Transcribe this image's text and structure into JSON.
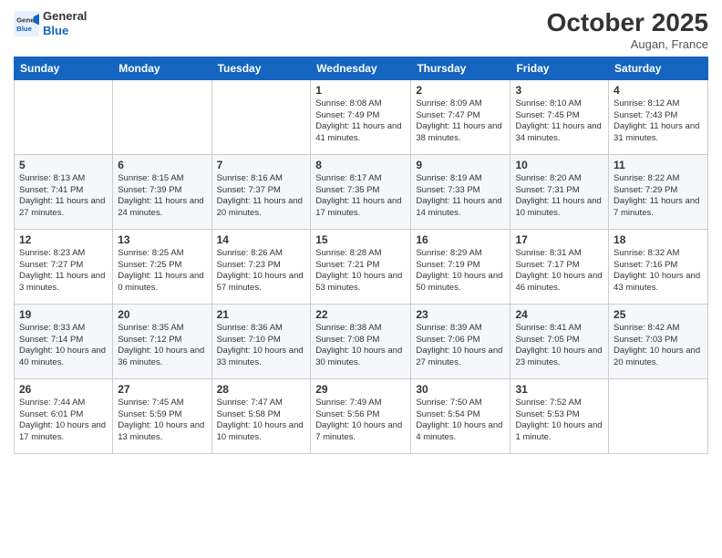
{
  "header": {
    "logo_line1": "General",
    "logo_line2": "Blue",
    "month": "October 2025",
    "location": "Augan, France"
  },
  "weekdays": [
    "Sunday",
    "Monday",
    "Tuesday",
    "Wednesday",
    "Thursday",
    "Friday",
    "Saturday"
  ],
  "weeks": [
    [
      {
        "day": "",
        "info": ""
      },
      {
        "day": "",
        "info": ""
      },
      {
        "day": "",
        "info": ""
      },
      {
        "day": "1",
        "info": "Sunrise: 8:08 AM\nSunset: 7:49 PM\nDaylight: 11 hours\nand 41 minutes."
      },
      {
        "day": "2",
        "info": "Sunrise: 8:09 AM\nSunset: 7:47 PM\nDaylight: 11 hours\nand 38 minutes."
      },
      {
        "day": "3",
        "info": "Sunrise: 8:10 AM\nSunset: 7:45 PM\nDaylight: 11 hours\nand 34 minutes."
      },
      {
        "day": "4",
        "info": "Sunrise: 8:12 AM\nSunset: 7:43 PM\nDaylight: 11 hours\nand 31 minutes."
      }
    ],
    [
      {
        "day": "5",
        "info": "Sunrise: 8:13 AM\nSunset: 7:41 PM\nDaylight: 11 hours\nand 27 minutes."
      },
      {
        "day": "6",
        "info": "Sunrise: 8:15 AM\nSunset: 7:39 PM\nDaylight: 11 hours\nand 24 minutes."
      },
      {
        "day": "7",
        "info": "Sunrise: 8:16 AM\nSunset: 7:37 PM\nDaylight: 11 hours\nand 20 minutes."
      },
      {
        "day": "8",
        "info": "Sunrise: 8:17 AM\nSunset: 7:35 PM\nDaylight: 11 hours\nand 17 minutes."
      },
      {
        "day": "9",
        "info": "Sunrise: 8:19 AM\nSunset: 7:33 PM\nDaylight: 11 hours\nand 14 minutes."
      },
      {
        "day": "10",
        "info": "Sunrise: 8:20 AM\nSunset: 7:31 PM\nDaylight: 11 hours\nand 10 minutes."
      },
      {
        "day": "11",
        "info": "Sunrise: 8:22 AM\nSunset: 7:29 PM\nDaylight: 11 hours\nand 7 minutes."
      }
    ],
    [
      {
        "day": "12",
        "info": "Sunrise: 8:23 AM\nSunset: 7:27 PM\nDaylight: 11 hours\nand 3 minutes."
      },
      {
        "day": "13",
        "info": "Sunrise: 8:25 AM\nSunset: 7:25 PM\nDaylight: 11 hours\nand 0 minutes."
      },
      {
        "day": "14",
        "info": "Sunrise: 8:26 AM\nSunset: 7:23 PM\nDaylight: 10 hours\nand 57 minutes."
      },
      {
        "day": "15",
        "info": "Sunrise: 8:28 AM\nSunset: 7:21 PM\nDaylight: 10 hours\nand 53 minutes."
      },
      {
        "day": "16",
        "info": "Sunrise: 8:29 AM\nSunset: 7:19 PM\nDaylight: 10 hours\nand 50 minutes."
      },
      {
        "day": "17",
        "info": "Sunrise: 8:31 AM\nSunset: 7:17 PM\nDaylight: 10 hours\nand 46 minutes."
      },
      {
        "day": "18",
        "info": "Sunrise: 8:32 AM\nSunset: 7:16 PM\nDaylight: 10 hours\nand 43 minutes."
      }
    ],
    [
      {
        "day": "19",
        "info": "Sunrise: 8:33 AM\nSunset: 7:14 PM\nDaylight: 10 hours\nand 40 minutes."
      },
      {
        "day": "20",
        "info": "Sunrise: 8:35 AM\nSunset: 7:12 PM\nDaylight: 10 hours\nand 36 minutes."
      },
      {
        "day": "21",
        "info": "Sunrise: 8:36 AM\nSunset: 7:10 PM\nDaylight: 10 hours\nand 33 minutes."
      },
      {
        "day": "22",
        "info": "Sunrise: 8:38 AM\nSunset: 7:08 PM\nDaylight: 10 hours\nand 30 minutes."
      },
      {
        "day": "23",
        "info": "Sunrise: 8:39 AM\nSunset: 7:06 PM\nDaylight: 10 hours\nand 27 minutes."
      },
      {
        "day": "24",
        "info": "Sunrise: 8:41 AM\nSunset: 7:05 PM\nDaylight: 10 hours\nand 23 minutes."
      },
      {
        "day": "25",
        "info": "Sunrise: 8:42 AM\nSunset: 7:03 PM\nDaylight: 10 hours\nand 20 minutes."
      }
    ],
    [
      {
        "day": "26",
        "info": "Sunrise: 7:44 AM\nSunset: 6:01 PM\nDaylight: 10 hours\nand 17 minutes."
      },
      {
        "day": "27",
        "info": "Sunrise: 7:45 AM\nSunset: 5:59 PM\nDaylight: 10 hours\nand 13 minutes."
      },
      {
        "day": "28",
        "info": "Sunrise: 7:47 AM\nSunset: 5:58 PM\nDaylight: 10 hours\nand 10 minutes."
      },
      {
        "day": "29",
        "info": "Sunrise: 7:49 AM\nSunset: 5:56 PM\nDaylight: 10 hours\nand 7 minutes."
      },
      {
        "day": "30",
        "info": "Sunrise: 7:50 AM\nSunset: 5:54 PM\nDaylight: 10 hours\nand 4 minutes."
      },
      {
        "day": "31",
        "info": "Sunrise: 7:52 AM\nSunset: 5:53 PM\nDaylight: 10 hours\nand 1 minute."
      },
      {
        "day": "",
        "info": ""
      }
    ]
  ]
}
